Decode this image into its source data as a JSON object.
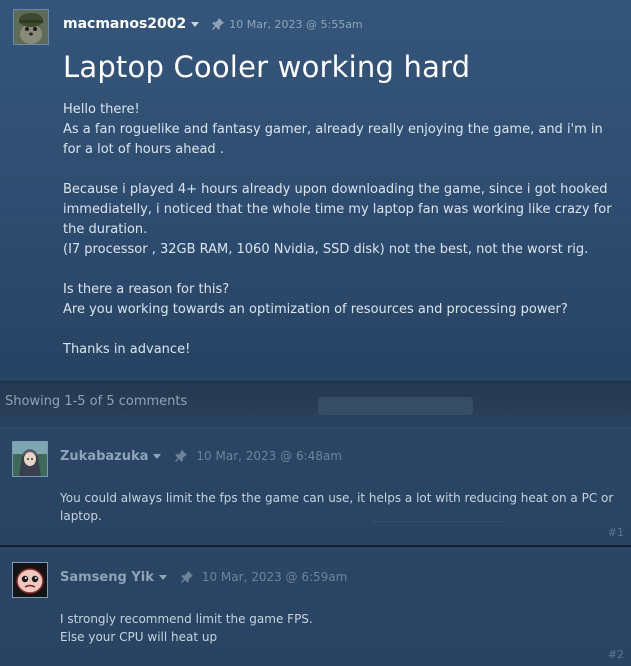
{
  "topic": {
    "author": "macmanos2002",
    "date": "10 Mar, 2023 @ 5:55am",
    "title": "Laptop Cooler working hard",
    "body": [
      "Hello there!",
      "As a fan roguelike and fantasy gamer, already really enjoying the game, and i'm in for a lot of hours ahead .",
      "",
      "Because i played 4+ hours already upon downloading the game, since i got hooked immediatelly, i noticed that the whole time my laptop fan was working like crazy for the duration.",
      "(I7 processor , 32GB RAM, 1060 Nvidia, SSD disk) not the best, not the worst rig.",
      "",
      "Is there a reason for this?",
      "Are you working towards an optimization of resources and processing power?",
      "",
      "Thanks in advance!"
    ]
  },
  "comments_header": {
    "showing": "Showing 1-5 of 5 comments"
  },
  "comments": [
    {
      "author": "Zukabazuka",
      "date": "10 Mar, 2023 @ 6:48am",
      "body": [
        "You could always limit the fps the game can use, it helps a lot with reducing heat on a PC or laptop."
      ],
      "number": "#1"
    },
    {
      "author": "Samseng Yik",
      "date": "10 Mar, 2023 @ 6:59am",
      "body": [
        "I strongly recommend limit the game FPS.",
        "Else your CPU will heat up"
      ],
      "number": "#2"
    }
  ],
  "icons": {
    "pin": "pin-icon",
    "caret": "chevron-down-icon"
  },
  "colors": {
    "background": "#1b2838",
    "title": "#ffffff",
    "body_text": "#dbe4ec",
    "muted": "#8fa4b8"
  }
}
